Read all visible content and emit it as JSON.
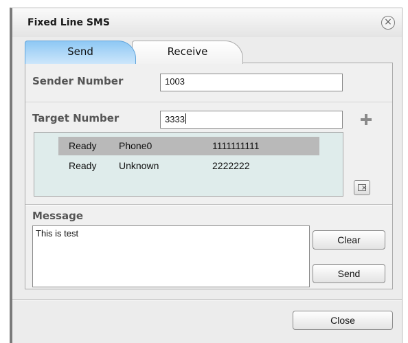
{
  "window": {
    "title": "Fixed Line SMS"
  },
  "tabs": [
    {
      "label": "Send",
      "active": true
    },
    {
      "label": "Receive",
      "active": false
    }
  ],
  "sender": {
    "label": "Sender Number",
    "value": "1003"
  },
  "target": {
    "label": "Target Number",
    "value": "3333"
  },
  "recipients": {
    "rows": [
      {
        "status": "Ready",
        "name": "Phone0",
        "number": "1111111111",
        "selected": true
      },
      {
        "status": "Ready",
        "name": "Unknown",
        "number": "2222222",
        "selected": false
      }
    ]
  },
  "message": {
    "label": "Message",
    "value": "This is test"
  },
  "buttons": {
    "clear": "Clear",
    "send": "Send",
    "close": "Close"
  },
  "icons": {
    "close_window": "close-circle-icon",
    "add": "plus-icon",
    "delete": "delete-entry-icon"
  },
  "colors": {
    "active_tab": "#8ec8f4",
    "list_bg": "#dfeceb",
    "selected_row": "#b9b9b9"
  }
}
